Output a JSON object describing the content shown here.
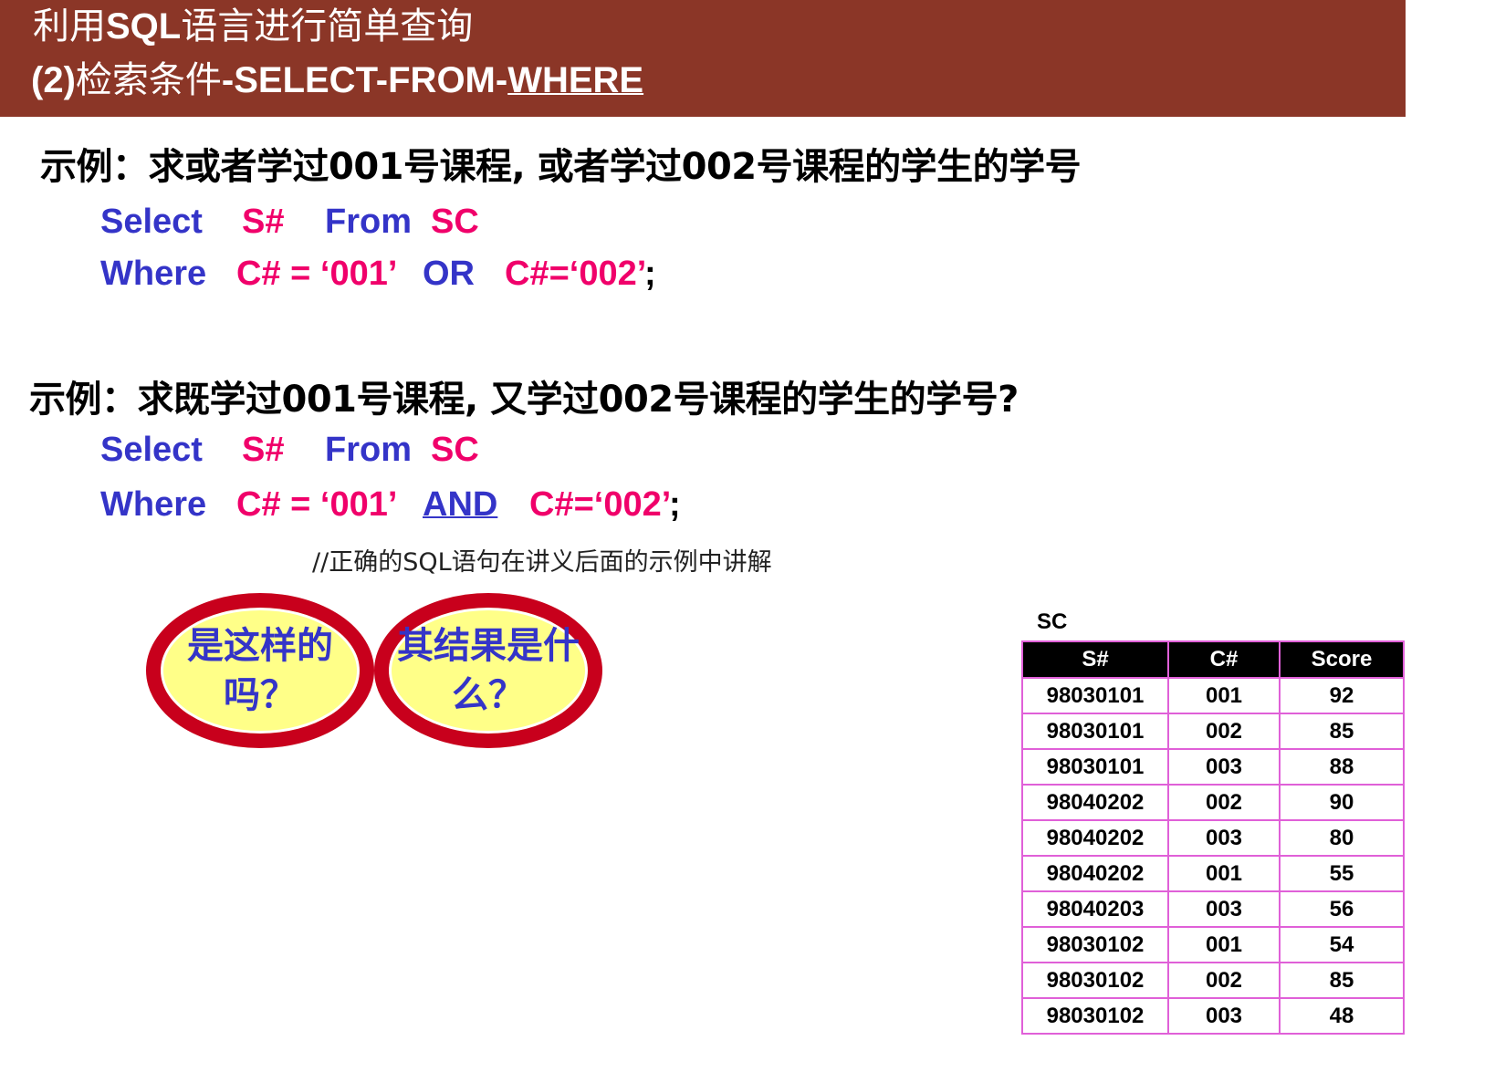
{
  "header": {
    "title_line1_a": "利用",
    "title_line1_b": "SQL",
    "title_line1_c": "语言进行简单查询",
    "title_line2_a": "(2)",
    "title_line2_b": "检索条件",
    "title_line2_c": "-SELECT-FROM-",
    "title_line2_d": "WHERE"
  },
  "example1": {
    "question": "示例：求或者学过001号课程, 或者学过002号课程的学生的学号",
    "select_kw": "Select",
    "select_col": "S#",
    "from_kw": "From",
    "from_table": "SC",
    "where_kw": "Where",
    "cond1": "C# = ‘001’",
    "op": "OR",
    "cond2": "C#=‘002’",
    "end": ";"
  },
  "example2": {
    "question": "示例：求既学过001号课程, 又学过002号课程的学生的学号?",
    "select_kw": "Select",
    "select_col": "S#",
    "from_kw": "From",
    "from_table": "SC",
    "where_kw": "Where",
    "cond1": "C# = ‘001’",
    "op": "AND",
    "cond2": "C#=‘002’",
    "end": ";"
  },
  "comment": "//正确的SQL语句在讲义后面的示例中讲解",
  "bubbles": [
    "是这样的吗？",
    "其结果是什么？"
  ],
  "table": {
    "title": "SC",
    "headers": [
      "S#",
      "C#",
      "Score"
    ],
    "rows": [
      [
        "98030101",
        "001",
        "92"
      ],
      [
        "98030101",
        "002",
        "85"
      ],
      [
        "98030101",
        "003",
        "88"
      ],
      [
        "98040202",
        "002",
        "90"
      ],
      [
        "98040202",
        "003",
        "80"
      ],
      [
        "98040202",
        "001",
        "55"
      ],
      [
        "98040203",
        "003",
        "56"
      ],
      [
        "98030102",
        "001",
        "54"
      ],
      [
        "98030102",
        "002",
        "85"
      ],
      [
        "98030102",
        "003",
        "48"
      ]
    ]
  },
  "colors": {
    "header_bg": "#8b3627",
    "keyword": "#3434c8",
    "identifier": "#f0006a",
    "bubble_fill": "#ffff88",
    "bubble_border": "#c8001c",
    "table_border": "#e060d8"
  }
}
